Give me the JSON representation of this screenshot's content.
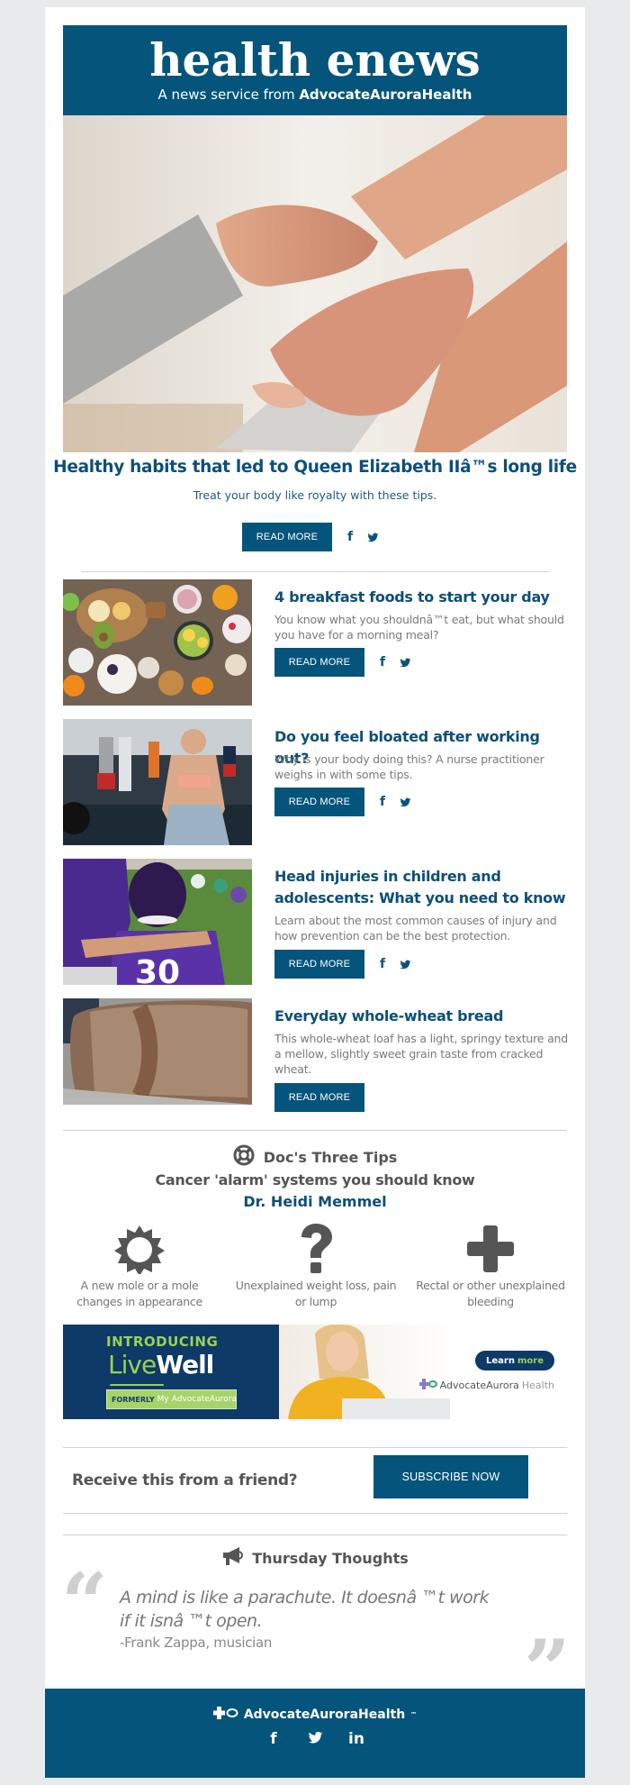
{
  "header": {
    "title": "health enews",
    "subtitle_prefix": "A news service from ",
    "subtitle_brand": "AdvocateAuroraHealth"
  },
  "colors": {
    "brand_blue": "#04547b",
    "headline_blue": "#0c4f79",
    "text_gray": "#7a7a7a",
    "page_bg": "#e9eaec",
    "livewell_green": "#9bd155",
    "livewell_navy": "#0d3a66"
  },
  "hero": {
    "image": "holding-hands-photo",
    "title": "Healthy habits that led to Queen Elizabeth IIâ™s long life",
    "dek": "Treat your body like royalty with these tips.",
    "read_more": "READ MORE",
    "facebook": "f"
  },
  "articles": [
    {
      "image": "breakfast-foods-photo",
      "title": "4 breakfast foods to start your day",
      "dek": "You know what you shouldnâ™t eat, but what should you have for a morning meal?",
      "read_more": "READ MORE",
      "facebook": "f",
      "has_social": true
    },
    {
      "image": "gym-workout-photo",
      "title": "Do you feel bloated after working out?",
      "dek": "Why is your body doing this? A nurse practitioner weighs in with some tips.",
      "read_more": "READ MORE",
      "facebook": "f",
      "has_social": true
    },
    {
      "image": "youth-football-photo",
      "title": "Head injuries in children and adolescents: What you need to know",
      "dek": "Learn about the most common causes of injury and how prevention can be the best protection.",
      "read_more": "READ MORE",
      "facebook": "f",
      "has_social": true
    },
    {
      "image": "whole-wheat-bread-photo",
      "title": "Everyday whole-wheat bread",
      "dek": "This whole-wheat loaf has a light, springy texture and a mellow, slightly sweet grain taste from cracked wheat.",
      "read_more": "READ MORE",
      "has_social": false
    }
  ],
  "docs_tips": {
    "icon": "lifebuoy-icon",
    "heading": "Doc's Three Tips",
    "subheading": "Cancer 'alarm' systems you should know",
    "doctor": "Dr. Heidi Memmel",
    "tips": [
      {
        "icon": "sun-icon",
        "text": "A new mole or a mole changes in appearance"
      },
      {
        "icon": "question-icon",
        "text": "Unexplained weight loss, pain or lump"
      },
      {
        "icon": "plus-icon",
        "text": "Rectal or other unexplained bleeding"
      }
    ]
  },
  "banner": {
    "introducing": "INTRODUCING",
    "live": "Live",
    "well": "Well",
    "formerly": "FORMERLY",
    "my": "My",
    "formerly_brand": "AdvocateAurora",
    "learn": "Learn",
    "more": "more",
    "brand_main": "AdvocateAurora",
    "brand_health": "Health"
  },
  "subscribe": {
    "prompt": "Receive this from a friend?",
    "button": "SUBSCRIBE NOW"
  },
  "thursday": {
    "icon": "megaphone-icon",
    "heading": "Thursday Thoughts",
    "open_quote": "“",
    "close_quote": "”",
    "quote": "A mind is like a parachute. It doesnâ ™t work if it isnâ ™t open.",
    "attribution": "-Frank Zappa, musician"
  },
  "footer": {
    "brand": "AdvocateAuroraHealth",
    "tm": "™",
    "facebook": "f",
    "linkedin": "in"
  }
}
